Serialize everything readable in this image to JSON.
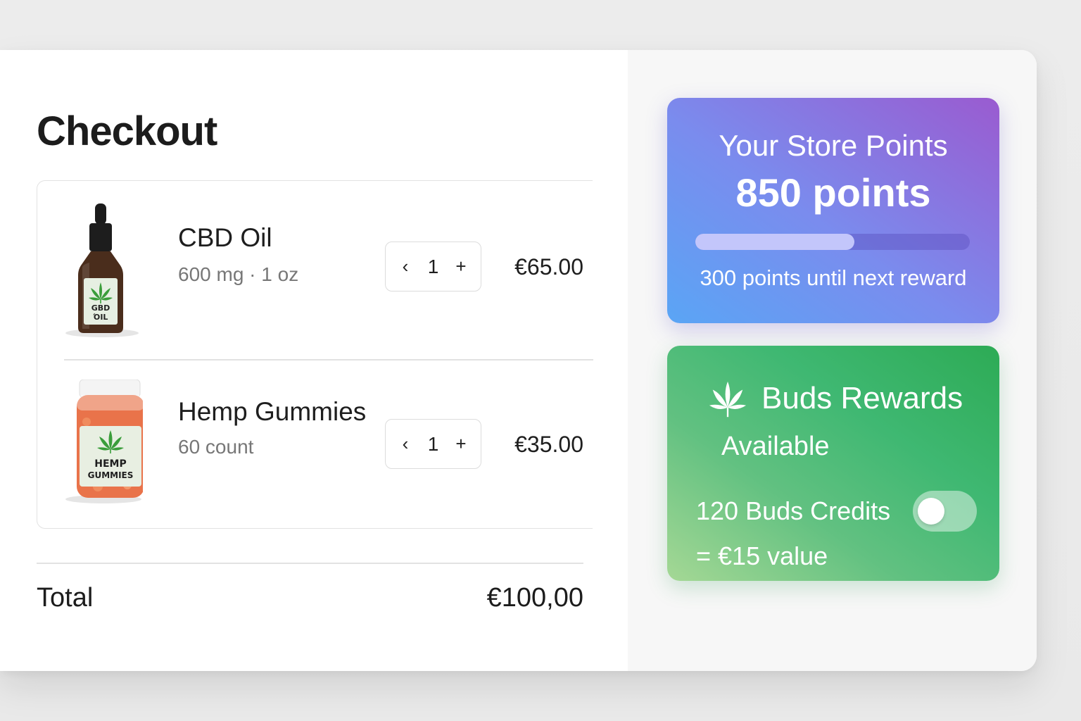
{
  "checkout": {
    "title": "Checkout",
    "items": [
      {
        "name": "CBD Oil",
        "description": "600 mg · 1 oz",
        "quantity": "1",
        "price": "€65.00",
        "image_label_line1": "GBD",
        "image_label_line2": "ΌIL",
        "image_icon": "cannabis-leaf-icon"
      },
      {
        "name": "Hemp Gummies",
        "description": "60 count",
        "quantity": "1",
        "price": "€35.00",
        "image_label_line1": "HEMP",
        "image_label_line2": "GUMMIES",
        "image_icon": "cannabis-leaf-icon"
      }
    ],
    "stepper": {
      "decrement_label": "‹",
      "increment_label": "+"
    },
    "total_label": "Total",
    "total_value": "€100,00"
  },
  "store_points": {
    "title": "Your Store Points",
    "value": "850 points",
    "progress": 0.58,
    "caption": "300 points until next reward"
  },
  "buds_rewards": {
    "icon": "cannabis-leaf-icon",
    "title": "Buds Rewards",
    "status": "Available",
    "credits_line1": "120 Buds Credits",
    "credits_line2": "= €15 value",
    "toggle_on": false
  },
  "colors": {
    "points_gradient": [
      "#5aa5f5",
      "#9a5bd0"
    ],
    "buds_gradient": [
      "#a5d895",
      "#2dab55"
    ],
    "leaf_green": "#3a9d3a"
  }
}
